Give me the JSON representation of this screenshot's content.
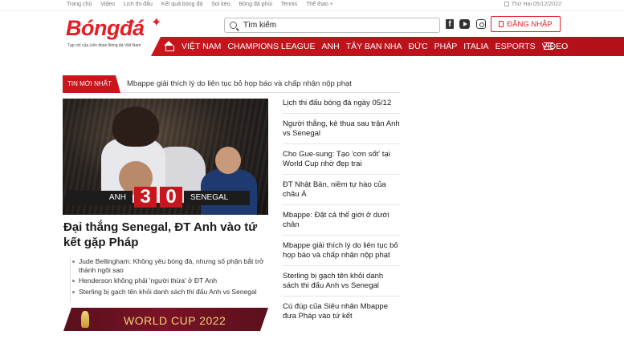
{
  "topbar": {
    "links": [
      "Trang chủ",
      "Video",
      "Lịch thi đấu",
      "Kết quả bóng đá",
      "Soi kèo",
      "Bóng đá phủi",
      "Tennis",
      "Thể thao +"
    ],
    "date": "Thứ Hai 05/12/2022"
  },
  "logo": {
    "text": "Bóngđá",
    "tagline": "Tạp chí của Liên đoàn Bóng đá Việt Nam"
  },
  "search": {
    "placeholder": "Tìm kiếm"
  },
  "login": {
    "label": "ĐĂNG NHẬP"
  },
  "nav": {
    "items": [
      "VIỆT NAM",
      "CHAMPIONS LEAGUE",
      "ANH",
      "TÂY BAN NHA",
      "ĐỨC",
      "PHÁP",
      "ITALIA",
      "ESPORTS",
      "VIDEO"
    ]
  },
  "ticker": {
    "label": "TIN MỚI NHẤT",
    "text": "Mbappe giải thích lý do liên tục bỏ họp báo và chấp nhận nộp phạt"
  },
  "hero": {
    "team_left": "ANH",
    "score_left": "3",
    "score_right": "0",
    "team_right": "SENEGAL",
    "headline": "Đại thắng Senegal, ĐT Anh vào tứ kết gặp Pháp"
  },
  "related": [
    "Jude Bellingham: Không yêu bóng đá, nhưng số phận bắt trở thành ngôi sao",
    "Henderson không phải 'người thừa' ở ĐT Anh",
    "Sterling bị gạch tên khỏi danh sách thi đấu Anh vs Senegal"
  ],
  "banner": {
    "text": "WORLD CUP 2022"
  },
  "news": [
    "Lịch thi đấu bóng đá ngày 05/12",
    "Người thắng, kẻ thua sau trận Anh vs Senegal",
    "Cho Gue-sung: Tạo 'cơn sốt' tại World Cup nhờ đẹp trai",
    "ĐT Nhật Bản, niềm tự hào của châu Á",
    "Mbappe: Đặt cả thế giới ở dưới chân",
    "Mbappe giải thích lý do liên tục bỏ họp báo và chấp nhận nộp phạt",
    "Sterling bị gạch tên khỏi danh sách thi đấu Anh vs Senegal",
    "Cú đúp của Siêu nhân Mbappe đưa Pháp vào tứ kết"
  ],
  "colors": {
    "brand_red": "#c9151c",
    "banner": "#7a1326",
    "gold": "#f3d27a"
  },
  "icons": [
    "search-icon",
    "facebook-icon",
    "youtube-icon",
    "instagram-icon",
    "lock-icon",
    "home-icon",
    "menu-icon",
    "calendar-icon",
    "trophy-icon"
  ]
}
